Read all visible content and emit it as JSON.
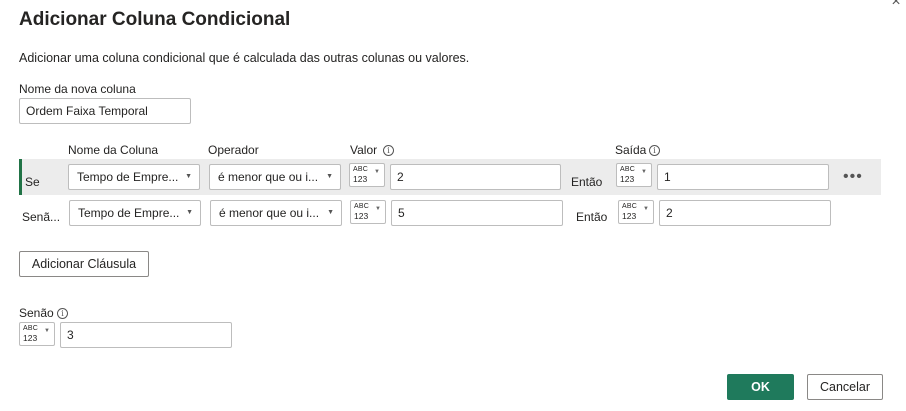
{
  "dialog": {
    "title": "Adicionar Coluna Condicional",
    "description": "Adicionar uma coluna condicional que é calculada das outras colunas ou valores.",
    "close_glyph": "×"
  },
  "new_column": {
    "label": "Nome da nova coluna",
    "value": "Ordem Faixa Temporal"
  },
  "headers": {
    "column_name": "Nome da Coluna",
    "operator": "Operador",
    "value": "Valor",
    "output": "Saída"
  },
  "type_selector": {
    "line1": "ABC",
    "line2": "123"
  },
  "clauses": [
    {
      "prefix": "Se",
      "column": "Tempo de Empre...",
      "operator": "é menor que ou i...",
      "value": "2",
      "then_label": "Então",
      "output": "1",
      "more": "•••"
    },
    {
      "prefix": "Senã...",
      "column": "Tempo de Empre...",
      "operator": "é menor que ou i...",
      "value": "5",
      "then_label": "Então",
      "output": "2"
    }
  ],
  "add_clause_button": "Adicionar Cláusula",
  "else": {
    "label": "Senão",
    "value": "3"
  },
  "footer": {
    "ok": "OK",
    "cancel": "Cancelar"
  },
  "colors": {
    "primary": "#1f7a5c",
    "row_highlight": "#ececec",
    "row_indicator": "#217346"
  }
}
